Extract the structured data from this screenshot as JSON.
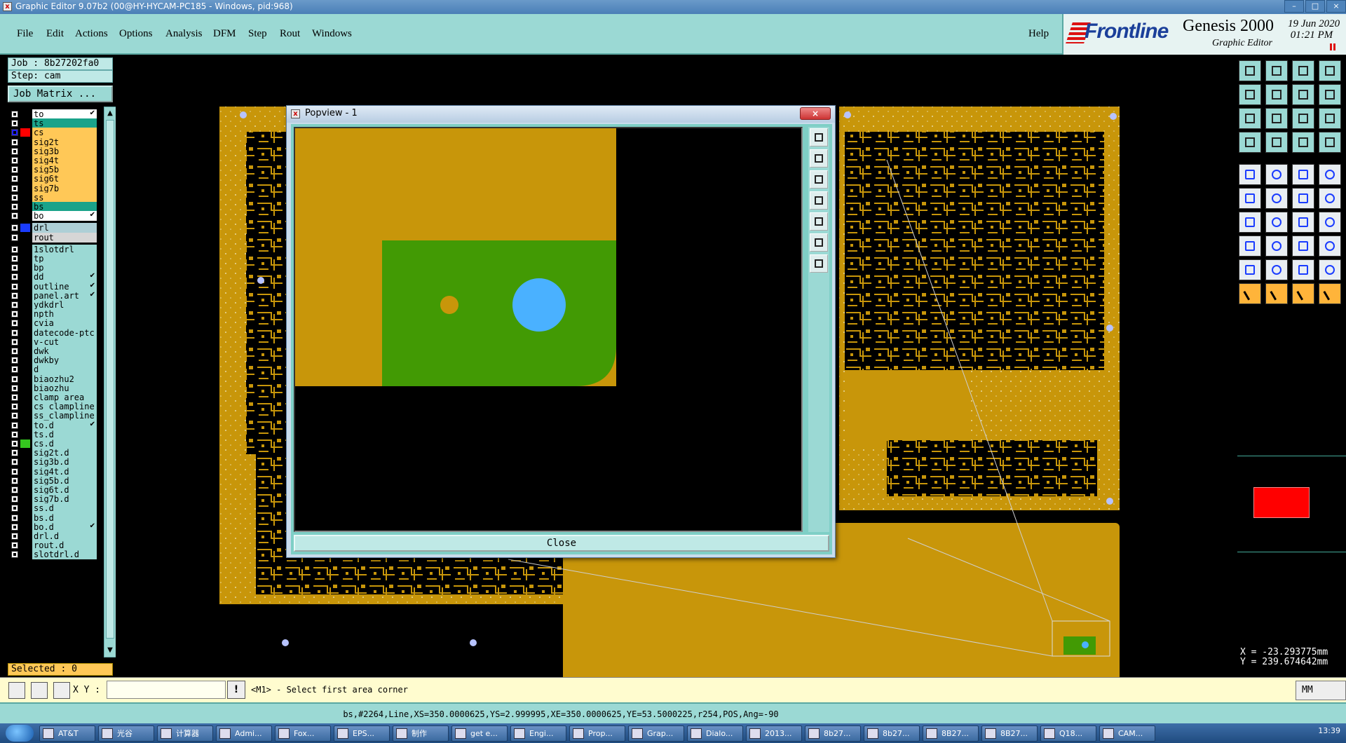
{
  "window": {
    "title": "Graphic Editor 9.07b2 (00@HY-HYCAM-PC185 - Windows, pid:968)",
    "controls": [
      "–",
      "□",
      "×"
    ]
  },
  "menu": {
    "items": [
      {
        "label": "File"
      },
      {
        "label": "Edit"
      },
      {
        "label": "Actions"
      },
      {
        "label": "Options"
      },
      {
        "label": "Analysis"
      },
      {
        "label": "DFM"
      },
      {
        "label": "Step"
      },
      {
        "label": "Rout"
      },
      {
        "label": "Windows"
      }
    ],
    "help": "Help"
  },
  "brand": {
    "logo": "Frontline",
    "product": "Genesis 2000",
    "subtitle": "Graphic Editor",
    "date": "19 Jun 2020\n 01:21 PM"
  },
  "left": {
    "job": "Job : 8b27202fa0",
    "step": "Step: cam",
    "job_matrix": "Job Matrix ...",
    "selected": "Selected : 0",
    "layers": [
      {
        "name": "to",
        "color": "#ffffff",
        "swatch": "#000000",
        "flag": "✔"
      },
      {
        "name": "ts",
        "color": "#1aa38a",
        "swatch": "#000000",
        "flag": ""
      },
      {
        "name": "cs",
        "color": "#ffc857",
        "swatch": "#ff0000",
        "flag": "",
        "active": true
      },
      {
        "name": "sig2t",
        "color": "#ffc857",
        "swatch": "#000000",
        "flag": ""
      },
      {
        "name": "sig3b",
        "color": "#ffc857",
        "swatch": "#000000",
        "flag": ""
      },
      {
        "name": "sig4t",
        "color": "#ffc857",
        "swatch": "#000000",
        "flag": ""
      },
      {
        "name": "sig5b",
        "color": "#ffc857",
        "swatch": "#000000",
        "flag": ""
      },
      {
        "name": "sig6t",
        "color": "#ffc857",
        "swatch": "#000000",
        "flag": ""
      },
      {
        "name": "sig7b",
        "color": "#ffc857",
        "swatch": "#000000",
        "flag": ""
      },
      {
        "name": "ss",
        "color": "#ffc857",
        "swatch": "#000000",
        "flag": ""
      },
      {
        "name": "bs",
        "color": "#1aa38a",
        "swatch": "#000000",
        "flag": ""
      },
      {
        "name": "bo",
        "color": "#ffffff",
        "swatch": "#000000",
        "flag": "✔"
      },
      {
        "name": "drl",
        "color": "#aecfd6",
        "swatch": "#1a3cff",
        "flag": "",
        "gap": true
      },
      {
        "name": "rout",
        "color": "#d6d6d6",
        "swatch": "#000000",
        "flag": ""
      },
      {
        "name": "1slotdrl",
        "color": "#9bd9d4",
        "swatch": "#000000",
        "flag": "",
        "gap": true
      },
      {
        "name": "tp",
        "color": "#9bd9d4",
        "swatch": "#000000",
        "flag": ""
      },
      {
        "name": "bp",
        "color": "#9bd9d4",
        "swatch": "#000000",
        "flag": ""
      },
      {
        "name": "dd",
        "color": "#9bd9d4",
        "swatch": "#000000",
        "flag": "✔"
      },
      {
        "name": "outline",
        "color": "#9bd9d4",
        "swatch": "#000000",
        "flag": "✔"
      },
      {
        "name": "panel.art",
        "color": "#9bd9d4",
        "swatch": "#000000",
        "flag": "✔"
      },
      {
        "name": "ydkdrl",
        "color": "#9bd9d4",
        "swatch": "#000000",
        "flag": ""
      },
      {
        "name": "npth",
        "color": "#9bd9d4",
        "swatch": "#000000",
        "flag": ""
      },
      {
        "name": "cvia",
        "color": "#9bd9d4",
        "swatch": "#000000",
        "flag": ""
      },
      {
        "name": "datecode-ptc",
        "color": "#9bd9d4",
        "swatch": "#000000",
        "flag": ""
      },
      {
        "name": "v-cut",
        "color": "#9bd9d4",
        "swatch": "#000000",
        "flag": ""
      },
      {
        "name": "dwk",
        "color": "#9bd9d4",
        "swatch": "#000000",
        "flag": ""
      },
      {
        "name": "dwkby",
        "color": "#9bd9d4",
        "swatch": "#000000",
        "flag": ""
      },
      {
        "name": "d",
        "color": "#9bd9d4",
        "swatch": "#000000",
        "flag": ""
      },
      {
        "name": "biaozhu2",
        "color": "#9bd9d4",
        "swatch": "#000000",
        "flag": ""
      },
      {
        "name": "biaozhu",
        "color": "#9bd9d4",
        "swatch": "#000000",
        "flag": ""
      },
      {
        "name": "clamp_area",
        "color": "#9bd9d4",
        "swatch": "#000000",
        "flag": ""
      },
      {
        "name": "cs_clampline",
        "color": "#9bd9d4",
        "swatch": "#000000",
        "flag": ""
      },
      {
        "name": "ss_clampline",
        "color": "#9bd9d4",
        "swatch": "#000000",
        "flag": ""
      },
      {
        "name": "to.d",
        "color": "#9bd9d4",
        "swatch": "#000000",
        "flag": "✔"
      },
      {
        "name": "ts.d",
        "color": "#9bd9d4",
        "swatch": "#000000",
        "flag": ""
      },
      {
        "name": "cs.d",
        "color": "#9bd9d4",
        "swatch": "#35c61f",
        "flag": ""
      },
      {
        "name": "sig2t.d",
        "color": "#9bd9d4",
        "swatch": "#000000",
        "flag": ""
      },
      {
        "name": "sig3b.d",
        "color": "#9bd9d4",
        "swatch": "#000000",
        "flag": ""
      },
      {
        "name": "sig4t.d",
        "color": "#9bd9d4",
        "swatch": "#000000",
        "flag": ""
      },
      {
        "name": "sig5b.d",
        "color": "#9bd9d4",
        "swatch": "#000000",
        "flag": ""
      },
      {
        "name": "sig6t.d",
        "color": "#9bd9d4",
        "swatch": "#000000",
        "flag": ""
      },
      {
        "name": "sig7b.d",
        "color": "#9bd9d4",
        "swatch": "#000000",
        "flag": ""
      },
      {
        "name": "ss.d",
        "color": "#9bd9d4",
        "swatch": "#000000",
        "flag": ""
      },
      {
        "name": "bs.d",
        "color": "#9bd9d4",
        "swatch": "#000000",
        "flag": ""
      },
      {
        "name": "bo.d",
        "color": "#9bd9d4",
        "swatch": "#000000",
        "flag": "✔"
      },
      {
        "name": "drl.d",
        "color": "#9bd9d4",
        "swatch": "#000000",
        "flag": ""
      },
      {
        "name": "rout.d",
        "color": "#9bd9d4",
        "swatch": "#000000",
        "flag": ""
      },
      {
        "name": "slotdrl.d",
        "color": "#9bd9d4",
        "swatch": "#000000",
        "flag": ""
      }
    ]
  },
  "popview": {
    "title": "Popview - 1",
    "close_x": "×",
    "close_button": "Close"
  },
  "colors": {
    "copper": "#c8960a",
    "copper_dark": "#a87d08",
    "mask_green": "#429a04",
    "drill_blue": "#4ab1ff",
    "panel_cyan": "#9bd9d4"
  },
  "right": {
    "x_coord": "X = -23.293775mm",
    "y_coord": "Y = 239.674642mm"
  },
  "cmd": {
    "xy_label": "X Y :",
    "xy_value": "",
    "prompt": "<M1> - Select first area corner",
    "units": "MM"
  },
  "status": {
    "text": "bs,#2264,Line,XS=350.0000625,YS=2.999995,XE=350.0000625,YE=53.5000225,r254,POS,Ang=-90"
  },
  "taskbar": {
    "items": [
      "AT&T",
      "光谷",
      "计算器",
      "Admi...",
      "Fox...",
      "EPS...",
      "制作",
      "get e...",
      "Engi...",
      "Prop...",
      "Grap...",
      "Dialo...",
      "2013...",
      "8b27...",
      "8b27...",
      "8B27...",
      "8B27...",
      "Q18...",
      "CAM..."
    ],
    "clock": "13:39"
  }
}
